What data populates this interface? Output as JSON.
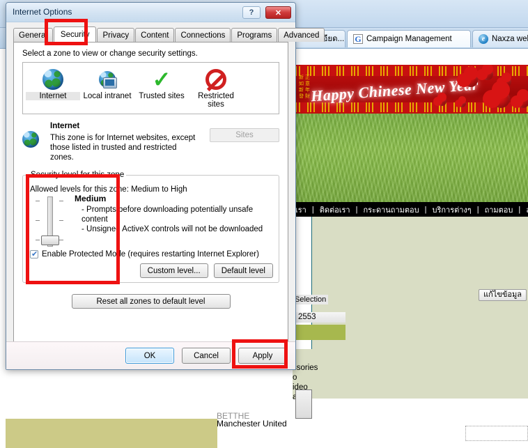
{
  "browser": {
    "tabs": [
      {
        "label": "รายละเอียด...",
        "icon": "none",
        "selected": false
      },
      {
        "label": "Campaign Management",
        "icon": "google-icon",
        "selected": true
      },
      {
        "label": "Naxza web l",
        "icon": "ie-icon",
        "selected": false
      }
    ],
    "banner": {
      "text": "Happy Chinese New Year",
      "chinese_column": "新 正 如 意 新 年 發 財"
    },
    "nav_items": [
      "เรา",
      "ติดต่อเรา",
      "กระดานถามตอบ",
      "บริการต่างๆ",
      "ถามตอบ",
      "ล"
    ],
    "selection_label": "Selection",
    "year_value": "2553",
    "edit_button": "แก้ไขข้อมูล",
    "category_lines": [
      "ssories",
      "o",
      "ideo",
      "ater"
    ],
    "footer_text_partial": "BETTHE",
    "footer_text": "Manchester United"
  },
  "dialog": {
    "title": "Internet Options",
    "help_button": "?",
    "close_button": "✕",
    "tabs": [
      {
        "label": "General",
        "active": false
      },
      {
        "label": "Security",
        "active": true
      },
      {
        "label": "Privacy",
        "active": false
      },
      {
        "label": "Content",
        "active": false
      },
      {
        "label": "Connections",
        "active": false
      },
      {
        "label": "Programs",
        "active": false
      },
      {
        "label": "Advanced",
        "active": false
      }
    ],
    "security": {
      "instruction": "Select a zone to view or change security settings.",
      "zones": [
        {
          "name": "Internet",
          "icon": "globe-icon",
          "selected": true
        },
        {
          "name": "Local intranet",
          "icon": "globe-monitor-icon",
          "selected": false
        },
        {
          "name": "Trusted sites",
          "icon": "green-check-icon",
          "selected": false
        },
        {
          "name": "Restricted sites",
          "icon": "restricted-circle-icon",
          "selected": false
        }
      ],
      "zone_title": "Internet",
      "zone_description": "This zone is for Internet websites, except those listed in trusted and restricted zones.",
      "sites_button": "Sites",
      "group_legend": "Security level for this zone",
      "allowed_levels": "Allowed levels for this zone: Medium to High",
      "level_name": "Medium",
      "level_bullets": [
        "- Prompts before downloading potentially unsafe content",
        "- Unsigned ActiveX controls will not be downloaded"
      ],
      "protected_mode_label": "Enable Protected Mode (requires restarting Internet Explorer)",
      "protected_mode_checked": true,
      "custom_level_button": "Custom level...",
      "default_level_button": "Default level",
      "reset_button": "Reset all zones to default level"
    },
    "footer": {
      "ok": "OK",
      "cancel": "Cancel",
      "apply": "Apply"
    }
  },
  "annotations": {
    "accent_color": "#ee1111",
    "highlights": [
      "security-tab",
      "security-level-group",
      "apply-button"
    ]
  }
}
